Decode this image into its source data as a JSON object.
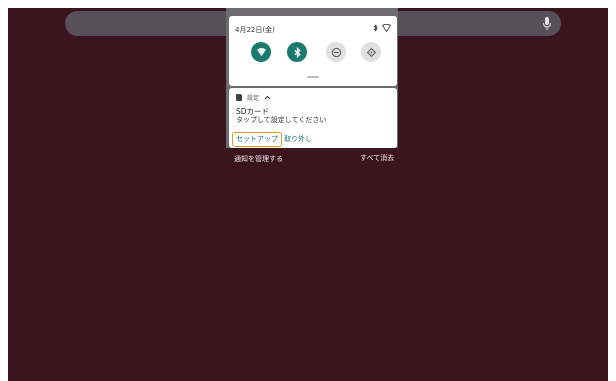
{
  "quick_settings": {
    "date": "4月22日(金)",
    "tiles": [
      {
        "name": "wifi",
        "state": "on"
      },
      {
        "name": "bluetooth",
        "state": "on"
      },
      {
        "name": "do-not-disturb",
        "state": "off"
      },
      {
        "name": "auto-rotate",
        "state": "off"
      }
    ]
  },
  "notification": {
    "app_name": "設定",
    "title": "SDカード",
    "text": "タップして設定してください",
    "actions": {
      "setup": "セットアップ",
      "eject": "取り外し"
    }
  },
  "footer": {
    "manage": "通知を管理する",
    "clear_all": "すべて消去"
  },
  "colors": {
    "wallpaper": "#3a141f",
    "accent": "#1a7a6e",
    "highlight": "#e8962a"
  }
}
